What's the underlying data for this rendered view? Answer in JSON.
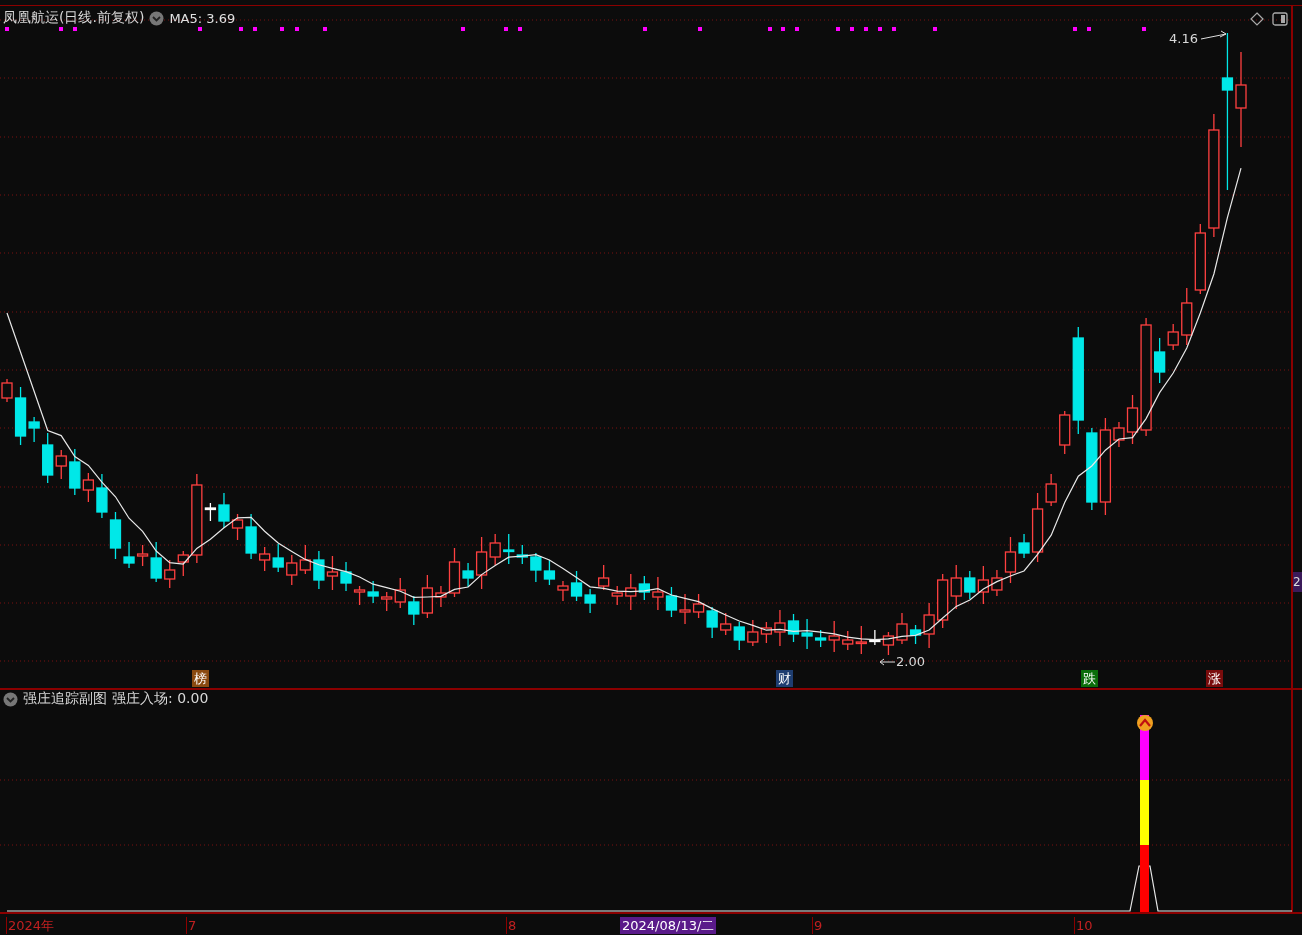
{
  "main_chart": {
    "title": "凤凰航运(日线.前复权)",
    "indicator": "MA5: 3.69",
    "high_label": "4.16",
    "low_label": "2.00",
    "axis_label": "2",
    "event_tags": [
      {
        "label": "榜",
        "color": "#8a4a10"
      },
      {
        "label": "财",
        "color": "#1e3d70"
      },
      {
        "label": "跌",
        "color": "#0b6d0b"
      },
      {
        "label": "涨",
        "color": "#7a0c0c"
      }
    ]
  },
  "sub_chart": {
    "title": "强庄追踪副图",
    "indicator": "强庄入场: 0.00"
  },
  "x_axis": [
    {
      "label": "2024年",
      "selected": false
    },
    {
      "label": "7",
      "selected": false
    },
    {
      "label": "8",
      "selected": false
    },
    {
      "label": "2024/08/13/二",
      "selected": true
    },
    {
      "label": "9",
      "selected": false
    },
    {
      "label": "10",
      "selected": false
    }
  ]
}
